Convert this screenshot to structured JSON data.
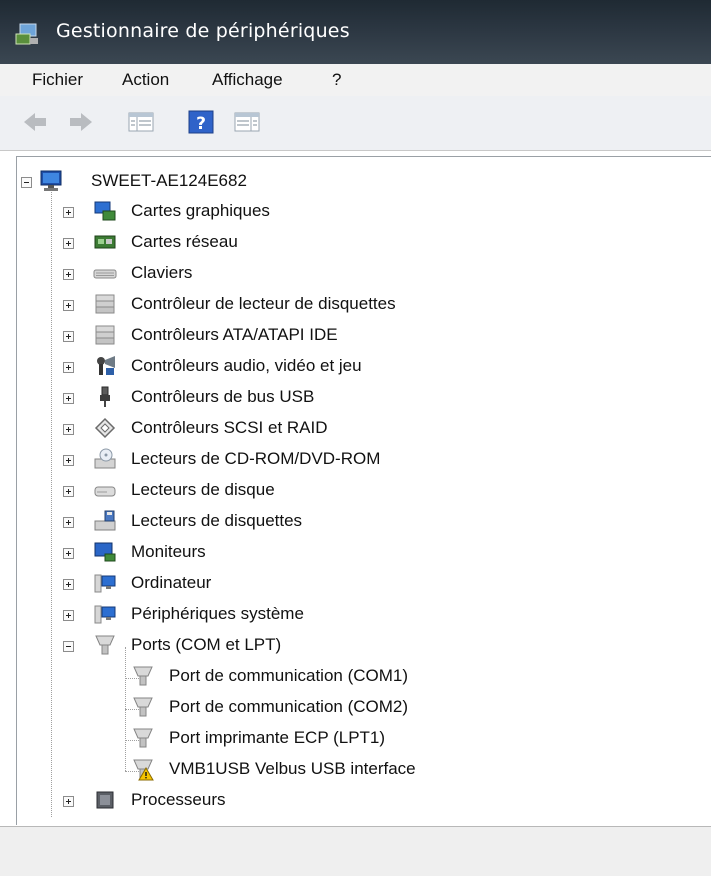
{
  "window": {
    "title": "Gestionnaire de périphériques"
  },
  "menu": [
    {
      "label": "Fichier"
    },
    {
      "label": "Action"
    },
    {
      "label": "Affichage"
    },
    {
      "label": "?"
    }
  ],
  "tree": {
    "root": "SWEET-AE124E682",
    "categories": [
      {
        "label": "Cartes graphiques",
        "icon": "display-adapter-icon",
        "expanded": false
      },
      {
        "label": "Cartes réseau",
        "icon": "network-card-icon",
        "expanded": false
      },
      {
        "label": "Claviers",
        "icon": "keyboard-icon",
        "expanded": false
      },
      {
        "label": "Contrôleur de lecteur de disquettes",
        "icon": "floppy-controller-icon",
        "expanded": false
      },
      {
        "label": "Contrôleurs ATA/ATAPI IDE",
        "icon": "ide-controller-icon",
        "expanded": false
      },
      {
        "label": "Contrôleurs audio, vidéo et jeu",
        "icon": "audio-video-icon",
        "expanded": false
      },
      {
        "label": "Contrôleurs de bus USB",
        "icon": "usb-icon",
        "expanded": false
      },
      {
        "label": "Contrôleurs SCSI et RAID",
        "icon": "scsi-icon",
        "expanded": false
      },
      {
        "label": "Lecteurs de CD-ROM/DVD-ROM",
        "icon": "cdrom-icon",
        "expanded": false
      },
      {
        "label": "Lecteurs de disque",
        "icon": "disk-drive-icon",
        "expanded": false
      },
      {
        "label": "Lecteurs de disquettes",
        "icon": "floppy-drive-icon",
        "expanded": false
      },
      {
        "label": "Moniteurs",
        "icon": "monitor-icon",
        "expanded": false
      },
      {
        "label": "Ordinateur",
        "icon": "computer-icon",
        "expanded": false
      },
      {
        "label": "Périphériques système",
        "icon": "system-devices-icon",
        "expanded": false
      },
      {
        "label": "Ports (COM et LPT)",
        "icon": "port-icon",
        "expanded": true,
        "children": [
          {
            "label": "Port de communication (COM1)",
            "icon": "port-icon",
            "warning": false
          },
          {
            "label": "Port de communication (COM2)",
            "icon": "port-icon",
            "warning": false
          },
          {
            "label": "Port imprimante ECP (LPT1)",
            "icon": "port-icon",
            "warning": false
          },
          {
            "label": "VMB1USB Velbus USB interface",
            "icon": "port-icon",
            "warning": true
          }
        ]
      },
      {
        "label": "Processeurs",
        "icon": "processor-icon",
        "expanded": false
      }
    ]
  },
  "colors": {
    "titlebar": "#2a3540",
    "warning": "#f5c400",
    "window_bg": "#ffffff"
  }
}
